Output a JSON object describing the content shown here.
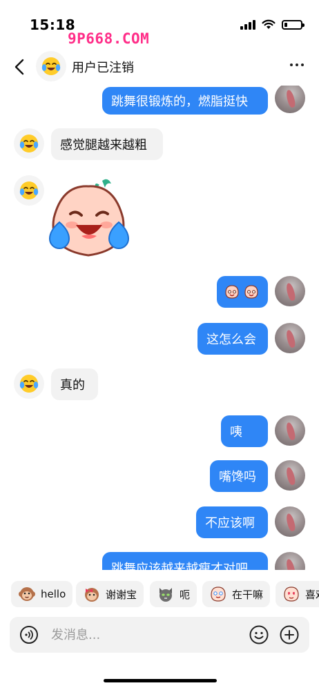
{
  "status_bar": {
    "time": "15:18",
    "watermark": "9P668.COM",
    "battery_level": 0.2
  },
  "header": {
    "title": "用户已注销"
  },
  "messages": [
    {
      "dir": "out",
      "type": "text",
      "text": "跳舞很锻炼的，燃脂挺快"
    },
    {
      "dir": "in",
      "type": "text",
      "text": "感觉腿越来越粗"
    },
    {
      "dir": "in",
      "type": "sticker",
      "sticker": "crying-peach-sticker"
    },
    {
      "dir": "out",
      "type": "emoji",
      "emoji": "crying-peach-emoji-pair"
    },
    {
      "dir": "out",
      "type": "text",
      "text": "这怎么会"
    },
    {
      "dir": "in",
      "type": "text",
      "text": "真的"
    },
    {
      "dir": "out",
      "type": "text",
      "text": "咦"
    },
    {
      "dir": "out",
      "type": "text",
      "text": "嘴馋吗"
    },
    {
      "dir": "out",
      "type": "text",
      "text": "不应该啊"
    },
    {
      "dir": "out",
      "type": "text",
      "text": "跳舞应该越来越瘦才对吧"
    }
  ],
  "quick_replies": [
    {
      "label": "hello",
      "icon": "monkey-icon"
    },
    {
      "label": "谢谢宝",
      "icon": "monkey-bow-icon"
    },
    {
      "label": "呃",
      "icon": "cat-icon"
    },
    {
      "label": "在干嘛",
      "icon": "peach-peek-icon"
    },
    {
      "label": "喜欢",
      "icon": "peach-heart-icon"
    }
  ],
  "input": {
    "placeholder": "发消息..."
  },
  "colors": {
    "accent": "#2f86f6",
    "incoming_bubble": "#f2f2f2"
  }
}
